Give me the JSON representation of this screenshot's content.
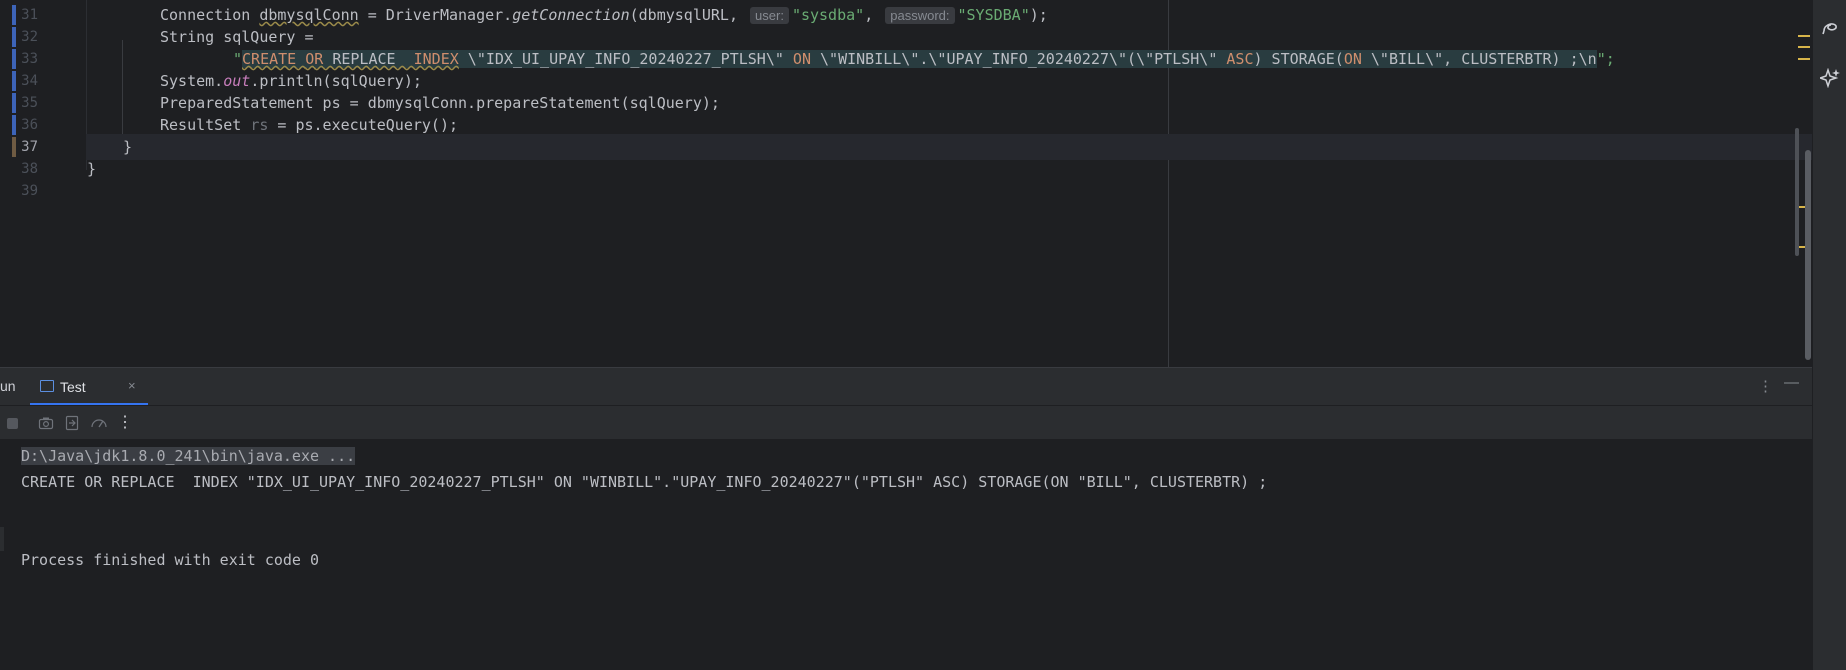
{
  "editor": {
    "lines": [
      {
        "num": "31"
      },
      {
        "num": "32"
      },
      {
        "num": "33"
      },
      {
        "num": "34"
      },
      {
        "num": "35"
      },
      {
        "num": "36"
      },
      {
        "num": "37"
      },
      {
        "num": "38"
      },
      {
        "num": "39"
      }
    ],
    "code": {
      "l31": {
        "a": "Connection ",
        "b": "dbmysqlConn",
        "c": " = DriverManager.",
        "d": "getConnection",
        "e": "(dbmysqlURL, ",
        "hint_user": "user:",
        "s1": "\"sysdba\"",
        "f": ", ",
        "hint_password": "password:",
        "s2": "\"SYSDBA\"",
        "g": ");"
      },
      "l32": {
        "a": "String sqlQuery ="
      },
      "l33": {
        "q": "\"",
        "k1": "CREATE",
        "p1": " ",
        "k2": "OR",
        "p2": " REPLACE  ",
        "k3": "INDEX",
        "p3": " \\\"IDX_UI_UPAY_INFO_20240227_PTLSH\\\" ",
        "k4": "ON",
        "p4": " \\\"WINBILL\\\".\\\"UPAY_INFO_20240227\\\"(\\\"PTLSH\\\" ",
        "k5": "ASC",
        "p5": ") STORAGE(",
        "k6": "ON",
        "p6": " \\\"BILL\\\", CLUSTERBTR) ;\\n",
        "end": "\";"
      },
      "l34": {
        "a": "System.",
        "b": "out",
        "c": ".println(sqlQuery);"
      },
      "l35": {
        "a": "PreparedStatement ps = dbmysqlConn.prepareStatement(sqlQuery);"
      },
      "l36": {
        "a": "ResultSet ",
        "b": "rs",
        "c": " = ps.executeQuery();"
      },
      "l37": {
        "a": "}"
      },
      "l38": {
        "a": "}"
      }
    }
  },
  "run": {
    "label": "un",
    "tab_label": "Test",
    "tab_close": "×",
    "console": {
      "cmd": "D:\\Java\\jdk1.8.0_241\\bin\\java.exe ...",
      "output": "CREATE OR REPLACE  INDEX \"IDX_UI_UPAY_INFO_20240227_PTLSH\" ON \"WINBILL\".\"UPAY_INFO_20240227\"(\"PTLSH\" ASC) STORAGE(ON \"BILL\", CLUSTERBTR) ;",
      "exit": "Process finished with exit code 0"
    }
  },
  "icons": [
    "ai-swirl-icon",
    "sparkle-icon",
    "stop-icon",
    "camera-icon",
    "restore-icon",
    "speedometer-icon",
    "more-icon",
    "options-icon",
    "minimize-icon",
    "console-tab-icon"
  ],
  "colors": {
    "keyword": "#cf8e6d",
    "string": "#6aab73",
    "static_field": "#c77dbb",
    "accent": "#3574f0",
    "background": "#1e1f22"
  }
}
